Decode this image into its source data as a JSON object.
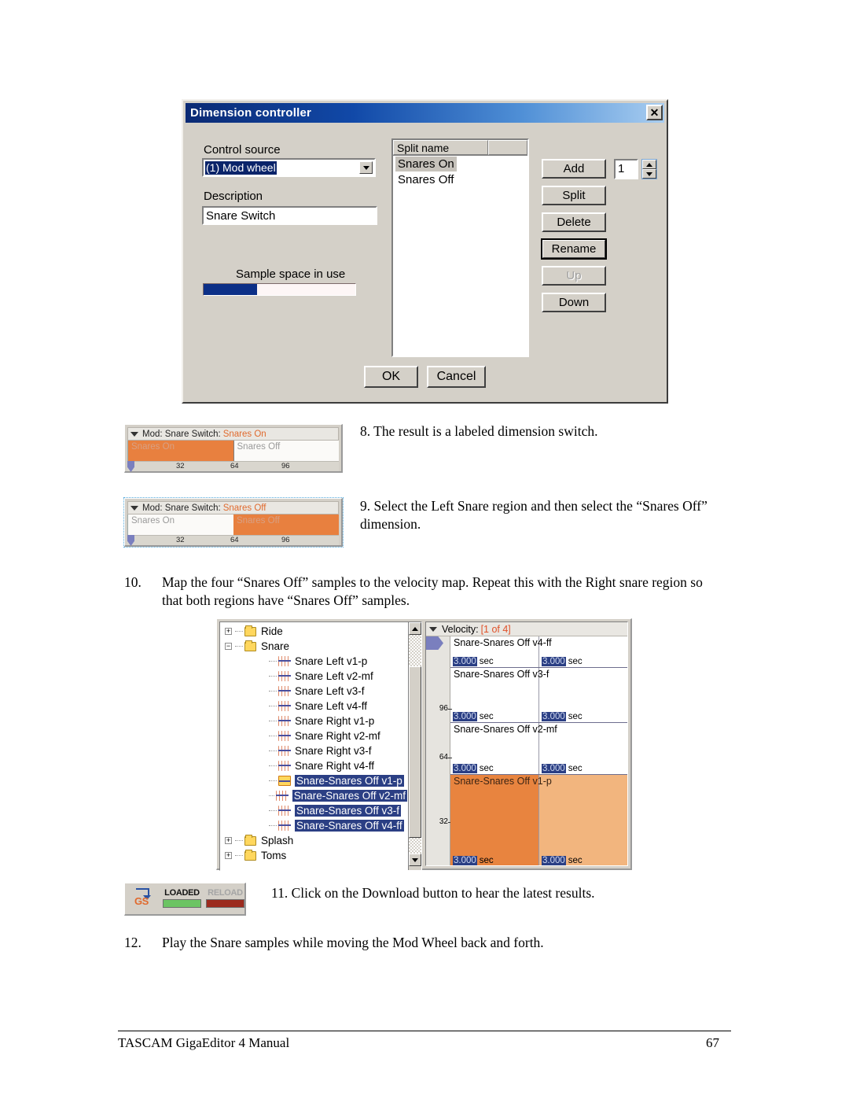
{
  "dialog": {
    "title": "Dimension controller",
    "close_label": "✕",
    "control_source_label": "Control source",
    "control_source_value": "(1) Mod wheel",
    "description_label": "Description",
    "description_value": "Snare Switch",
    "sample_space_label": "Sample space in use",
    "sample_space_percent": 35,
    "split_header": "Split name",
    "splits": [
      {
        "name": "Snares On",
        "selected": true
      },
      {
        "name": "Snares Off",
        "selected": false
      }
    ],
    "buttons": {
      "add": "Add",
      "split": "Split",
      "delete": "Delete",
      "rename": "Rename",
      "up": "Up",
      "down": "Down",
      "ok": "OK",
      "cancel": "Cancel"
    },
    "spinner_value": "1"
  },
  "dimension_switches": [
    {
      "header_label": "Mod: Snare Switch:",
      "header_value": "Snares On",
      "left_cell": "Snares On",
      "right_cell": "Snares Off",
      "active_side": "left",
      "ticks": [
        "32",
        "64",
        "96"
      ]
    },
    {
      "header_label": "Mod: Snare Switch:",
      "header_value": "Snares Off",
      "left_cell": "Snares On",
      "right_cell": "Snares Off",
      "active_side": "right",
      "ticks": [
        "32",
        "64",
        "96"
      ]
    }
  ],
  "instructions": {
    "step8": "8. The result is a labeled dimension switch.",
    "step9_line1": "9. Select the Left Snare region and then select the “Snares Off”",
    "step9_line2": "dimension.",
    "step10_num": "10.",
    "step10_line1": "Map the four “Snares Off” samples to the velocity map.  Repeat this with the Right snare region so",
    "step10_line2": "that both regions have “Snares Off” samples.",
    "step11": "11. Click on the Download button to hear the latest results.",
    "step12_num": "12.",
    "step12_text": "Play the Snare samples while moving the Mod Wheel back and forth."
  },
  "editor": {
    "tree": [
      {
        "label": "Ride",
        "type": "folder",
        "depth": 0,
        "expander": "+",
        "selected": false
      },
      {
        "label": "Snare",
        "type": "folder",
        "depth": 0,
        "expander": "−",
        "selected": false
      },
      {
        "label": "Snare Left v1-p",
        "type": "wave",
        "depth": 1,
        "selected": false
      },
      {
        "label": "Snare Left v2-mf",
        "type": "wave",
        "depth": 1,
        "selected": false
      },
      {
        "label": "Snare Left v3-f",
        "type": "wave",
        "depth": 1,
        "selected": false
      },
      {
        "label": "Snare Left v4-ff",
        "type": "wave",
        "depth": 1,
        "selected": false
      },
      {
        "label": "Snare Right v1-p",
        "type": "wave",
        "depth": 1,
        "selected": false
      },
      {
        "label": "Snare Right v2-mf",
        "type": "wave",
        "depth": 1,
        "selected": false
      },
      {
        "label": "Snare Right v3-f",
        "type": "wave",
        "depth": 1,
        "selected": false
      },
      {
        "label": "Snare Right v4-ff",
        "type": "wave",
        "depth": 1,
        "selected": false
      },
      {
        "label": "Snare-Snares Off v1-p",
        "type": "wave-hl",
        "depth": 1,
        "selected": true
      },
      {
        "label": "Snare-Snares Off v2-mf",
        "type": "wave",
        "depth": 1,
        "selected": true
      },
      {
        "label": "Snare-Snares Off v3-f",
        "type": "wave",
        "depth": 1,
        "selected": true
      },
      {
        "label": "Snare-Snares Off v4-ff",
        "type": "wave",
        "depth": 1,
        "selected": true
      },
      {
        "label": "Splash",
        "type": "folder",
        "depth": 0,
        "expander": "+",
        "selected": false
      },
      {
        "label": "Toms",
        "type": "folder",
        "depth": 0,
        "expander": "+",
        "selected": false
      }
    ],
    "velocity": {
      "header_label": "Velocity:",
      "header_value": "[1 of 4]",
      "ruler_ticks": [
        "96",
        "64",
        "32"
      ],
      "rows": [
        {
          "name": "Snare-Snares Off v4-ff",
          "sec_left": "3.000",
          "sec_right": "3.000",
          "unit": "sec",
          "filled": false
        },
        {
          "name": "Snare-Snares Off v3-f",
          "sec_left": "3.000",
          "sec_right": "3.000",
          "unit": "sec",
          "filled": false
        },
        {
          "name": "Snare-Snares Off v2-mf",
          "sec_left": "3.000",
          "sec_right": "3.000",
          "unit": "sec",
          "filled": false
        },
        {
          "name": "Snare-Snares Off v1-p",
          "sec_left": "3.000",
          "sec_right": "3.000",
          "unit": "sec",
          "filled": true
        }
      ]
    }
  },
  "loaded_widget": {
    "icon_text": "GS",
    "loaded_label": "LOADED",
    "reload_label": "RELOAD",
    "loaded_color": "#6cc463",
    "reload_color": "#9c2b1e"
  },
  "footer": {
    "left": "TASCAM GigaEditor 4 Manual",
    "right": "67"
  }
}
